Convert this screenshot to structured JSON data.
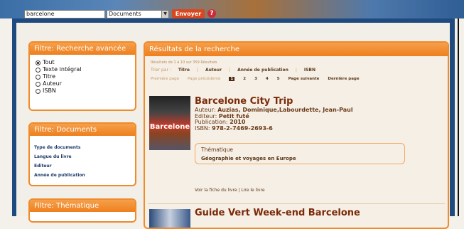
{
  "search": {
    "query": "barcelone",
    "scope": "Documents",
    "submit_label": "Envoyer",
    "help_symbol": "?"
  },
  "filters": {
    "search_title": "Filtre: Recherche avancée",
    "search_options": [
      "Tout",
      "Texte intégral",
      "Titre",
      "Auteur",
      "ISBN"
    ],
    "selected_option": "Tout",
    "documents_title": "Filtre: Documents",
    "documents_items": [
      "Type de documents",
      "Langue du livre",
      "Editeur",
      "Année de publication"
    ],
    "thematic_title": "Filtre: Thématique"
  },
  "results": {
    "title": "Résultats de la recherche",
    "count": "Résultats de 1 à 10 sur 359 Résultats",
    "sort_label": "Trier par :",
    "sort_options": [
      "Titre",
      "Auteur",
      "Année de publication",
      "ISBN"
    ],
    "pager": {
      "first": "Première page",
      "prev": "Page précédente",
      "pages": [
        "1",
        "2",
        "3",
        "4",
        "5"
      ],
      "current": "1",
      "next": "Page suivante",
      "last": "Dernière page"
    },
    "books": [
      {
        "title": "Barcelone City Trip",
        "cover_text": "Barcelone",
        "author_label": "Auteur:",
        "author": "Auzias, Dominique,Labourdette, Jean-Paul",
        "editor_label": "Editeur:",
        "editor": "Petit futé",
        "pub_label": "Publication:",
        "pub": "2010",
        "isbn_label": "ISBN:",
        "isbn": "978-2-7469-2693-6",
        "theme_title": "Thématique",
        "theme": "Géographie et voyages en Europe",
        "link_sheet": "Voir la fiche du livre",
        "link_sep": "|",
        "link_read": "Lire le livre"
      },
      {
        "title": "Guide Vert Week-end Barcelone"
      }
    ]
  }
}
